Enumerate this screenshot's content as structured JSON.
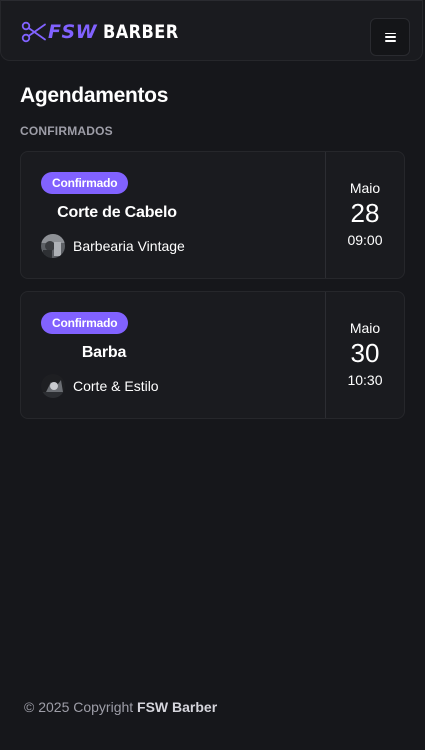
{
  "header": {
    "logo_prefix": "FSW",
    "logo_name": "BARBER",
    "menu_icon": "hamburger-icon",
    "brand_color": "#8162ff"
  },
  "page": {
    "title": "Agendamentos",
    "section_label": "CONFIRMADOS"
  },
  "bookings": [
    {
      "status": "Confirmado",
      "service": "Corte de Cabelo",
      "barbershop": "Barbearia Vintage",
      "month": "Maio",
      "day": "28",
      "time": "09:00"
    },
    {
      "status": "Confirmado",
      "service": "Barba",
      "barbershop": "Corte & Estilo",
      "month": "Maio",
      "day": "30",
      "time": "10:30"
    }
  ],
  "footer": {
    "copyright": "© 2025 Copyright",
    "brand": "FSW Barber"
  }
}
